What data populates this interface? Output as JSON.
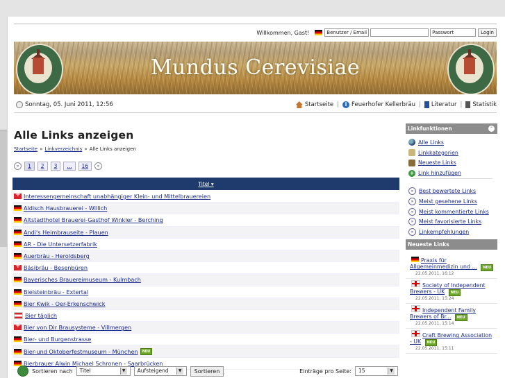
{
  "header": {
    "welcome": "Willkommen, Gast!",
    "login_method": "Benutzer / Email",
    "password_placeholder": "Passwort",
    "login_button": "Login"
  },
  "banner": {
    "title": "Mundus Cerevisiae"
  },
  "infobar": {
    "date": "Sonntag, 05. Juni 2011, 12:56",
    "nav": [
      {
        "label": "Startseite",
        "icon": "home-icon"
      },
      {
        "label": "Feuerhofer Kellerbräu",
        "icon": "info-icon"
      },
      {
        "label": "Literatur",
        "icon": "book-icon"
      },
      {
        "label": "Statistik",
        "icon": "statistics-icon"
      }
    ]
  },
  "main": {
    "title": "Alle Links anzeigen",
    "breadcrumb": [
      "Startseite",
      "Linkverzeichnis",
      "Alle Links anzeigen"
    ],
    "pager": [
      "1",
      "2",
      "3",
      "...",
      "16"
    ],
    "column_header": "Titel ▾",
    "links": [
      {
        "title": "Interessengemeinschaft unabhängiger Klein- und Mittelbrauereien",
        "flag": "ch",
        "new": false
      },
      {
        "title": "Aldisch Hausbrauerei - Willich",
        "flag": "de",
        "new": false
      },
      {
        "title": "Altstadthotel Brauerei-Gasthof Winkler - Berching",
        "flag": "de",
        "new": false
      },
      {
        "title": "Andi's Heimbrauseite - Plauen",
        "flag": "de",
        "new": false
      },
      {
        "title": "AR - Die Untersetzerfabrik",
        "flag": "de",
        "new": false
      },
      {
        "title": "Auerbräu - Heroldsberg",
        "flag": "de",
        "new": false
      },
      {
        "title": "Bäsibräu - Besenbüren",
        "flag": "ch",
        "new": false
      },
      {
        "title": "Bayerisches Brauereimuseum - Kulmbach",
        "flag": "de",
        "new": false
      },
      {
        "title": "Bielsteinbräu - Extertal",
        "flag": "de",
        "new": false
      },
      {
        "title": "Bier Kwik - Oer-Erkenschwick",
        "flag": "de",
        "new": false
      },
      {
        "title": "Bier täglich",
        "flag": "at",
        "new": false
      },
      {
        "title": "Bier von Dir Brausysteme - Villmergen",
        "flag": "ch",
        "new": false
      },
      {
        "title": "Bier- und Burgenstrasse",
        "flag": "de",
        "new": false
      },
      {
        "title": "Bier-und Oktoberfestmuseum - München",
        "flag": "de",
        "new": true
      },
      {
        "title": "Bierbrauer Alwin Michael Schronen - Saarbrücken",
        "flag": "de",
        "new": false
      }
    ],
    "new_badge": "NEU",
    "sort": {
      "label": "Sortieren nach",
      "field": "Titel",
      "order": "Aufsteigend",
      "button": "Sortieren",
      "per_page_label": "Einträge pro Seite:",
      "per_page": "15"
    }
  },
  "sidebar": {
    "linkfunktionen_title": "Linkfunktionen",
    "items": [
      {
        "label": "Alle Links",
        "icon": "globe-icon"
      },
      {
        "label": "Linkkategorien",
        "icon": "folder-icon"
      },
      {
        "label": "Neueste Links",
        "icon": "tree-icon"
      },
      {
        "label": "Link hinzufügen",
        "icon": "add-icon"
      }
    ],
    "more": [
      {
        "label": "Best bewertete Links"
      },
      {
        "label": "Meist gesehene Links"
      },
      {
        "label": "Meist kommentierte Links"
      },
      {
        "label": "Meist favorisierte Links"
      },
      {
        "label": "Linkempfehlungen"
      }
    ],
    "newest_title": "Neueste Links",
    "newest": [
      {
        "title": "Praxis für Allgemeinmedizin und ...",
        "date": "22.05.2011, 16:12",
        "flag": "de"
      },
      {
        "title": "Society of Independent Brewers - UK",
        "date": "22.05.2011, 15:24",
        "flag": "uk"
      },
      {
        "title": "Independent Family Brewers of Br...",
        "date": "22.05.2011, 15:14",
        "flag": "uk"
      },
      {
        "title": "Craft Brewing Association - UK",
        "date": "22.05.2011, 15:11",
        "flag": "uk"
      }
    ]
  }
}
